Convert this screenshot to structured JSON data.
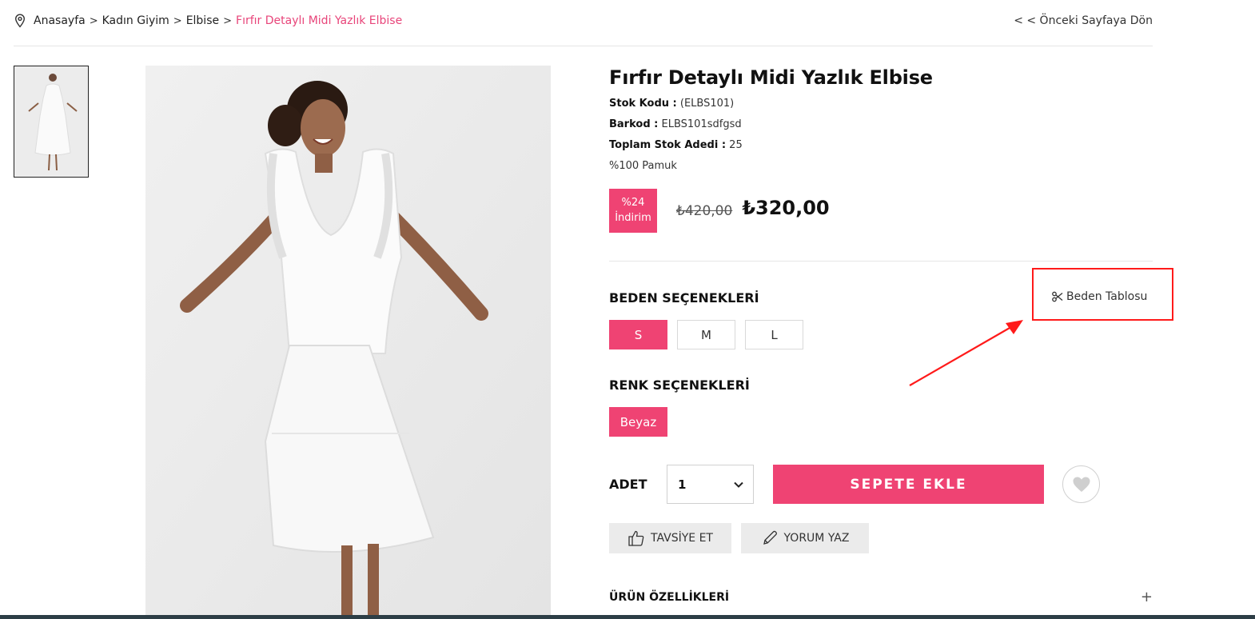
{
  "breadcrumb": {
    "items": [
      "Anasayfa",
      "Kadın Giyim",
      "Elbise"
    ],
    "current": "Fırfır Detaylı Midi Yazlık Elbise",
    "separator": ">"
  },
  "back_link": "< < Önceki Sayfaya Dön",
  "product": {
    "title": "Fırfır Detaylı Midi Yazlık Elbise",
    "stock_code_label": "Stok Kodu :",
    "stock_code": "(ELBS101)",
    "barcode_label": "Barkod :",
    "barcode": "ELBS101sdfgsd",
    "stock_qty_label": "Toplam Stok Adedi :",
    "stock_qty": "25",
    "material": "%100 Pamuk",
    "discount_percent": "%24",
    "discount_label": "İndirim",
    "old_price": "₺420,00",
    "new_price": "₺320,00"
  },
  "sizes": {
    "title": "BEDEN SEÇENEKLERİ",
    "size_chart_label": "Beden Tablosu",
    "options": [
      "S",
      "M",
      "L"
    ],
    "selected": "S"
  },
  "colors": {
    "title": "RENK SEÇENEKLERİ",
    "options": [
      "Beyaz"
    ]
  },
  "purchase": {
    "qty_label": "ADET",
    "qty_value": "1",
    "add_to_cart": "SEPETE EKLE"
  },
  "actions": {
    "recommend": "TAVSİYE ET",
    "review": "YORUM YAZ"
  },
  "features": {
    "title": "ÜRÜN ÖZELLİKLERİ",
    "toggle": "+"
  },
  "colors_theme": {
    "accent": "#ef4373",
    "annotation": "#ff1a1a"
  }
}
